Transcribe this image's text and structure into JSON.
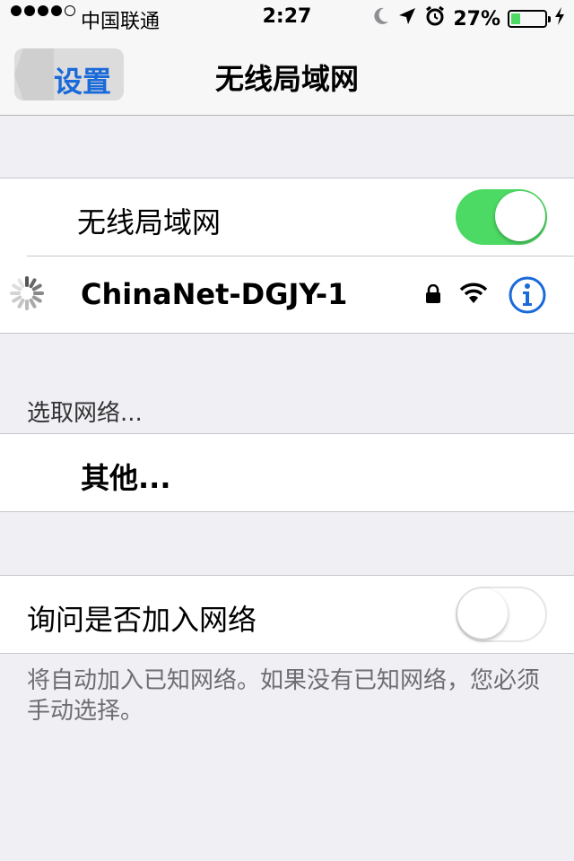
{
  "status_bar": {
    "signal_dots_filled": 4,
    "signal_dots_total": 5,
    "carrier": "中国联通",
    "time": "2:27",
    "battery_percent": "27%",
    "battery_level": 0.27,
    "icons": [
      "moon-icon",
      "location-arrow-icon",
      "alarm-clock-icon",
      "battery-icon",
      "charging-bolt-icon"
    ]
  },
  "nav": {
    "back_label": "设置",
    "title": "无线局域网"
  },
  "wifi_section": {
    "toggle_label": "无线局域网",
    "toggle_on": true,
    "network": {
      "name": "ChinaNet-DGJY-1",
      "secured": true
    }
  },
  "choose_section": {
    "header": "选取网络...",
    "other_label": "其他..."
  },
  "ask_section": {
    "toggle_label": "询问是否加入网络",
    "toggle_on": false,
    "footer": "将自动加入已知网络。如果没有已知网络，您必须手动选择。"
  },
  "colors": {
    "accent": "#1a6ad9",
    "toggle_on": "#4cd964",
    "background": "#efeff4"
  }
}
